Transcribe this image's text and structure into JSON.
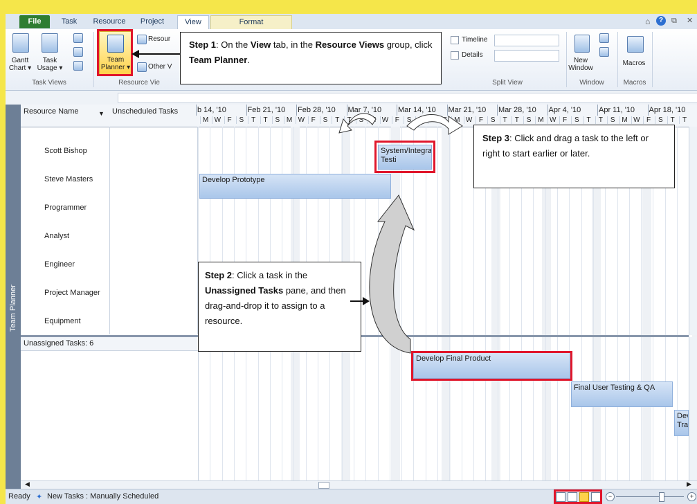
{
  "tabs": {
    "file": "File",
    "task": "Task",
    "resource": "Resource",
    "project": "Project",
    "view": "View",
    "format": "Format"
  },
  "ribbon": {
    "gantt": "Gantt",
    "chart": "Chart ▾",
    "task": "Task",
    "usage": "Usage ▾",
    "team": "Team",
    "planner": "Planner ▾",
    "resource_sheet": "Resour",
    "other_views": "Other V",
    "task_views_label": "Task Views",
    "resource_views_label": "Resource Vie",
    "timeline": "Timeline",
    "details": "Details",
    "split_view_label": "Split View",
    "new": "New",
    "window": "Window",
    "window_label": "Window",
    "macros": "Macros",
    "macros_label": "Macros"
  },
  "columns": {
    "resource_name": "Resource Name",
    "unscheduled": "Unscheduled Tasks"
  },
  "dates": [
    "b 14, '10",
    "Feb 21, '10",
    "Feb 28, '10",
    "Mar 7, '10",
    "Mar 14, '10",
    "Mar 21, '10",
    "Mar 28, '10",
    "Apr 4, '10",
    "Apr 11, '10",
    "Apr 18, '10"
  ],
  "days": [
    "M",
    "W",
    "F",
    "S",
    "T",
    "T",
    "S",
    "M",
    "W",
    "F",
    "S",
    "T",
    "T",
    "S",
    "M",
    "W",
    "F",
    "S",
    "T",
    "T",
    "S",
    "M",
    "W",
    "F",
    "S",
    "T",
    "T",
    "S",
    "M",
    "W",
    "F",
    "S",
    "T",
    "T",
    "S",
    "M",
    "W",
    "F",
    "S",
    "T",
    "T"
  ],
  "resources": [
    "Scott Bishop",
    "Steve Masters",
    "Programmer",
    "Analyst",
    "Engineer",
    "Project Manager",
    "Equipment"
  ],
  "tasks": {
    "system_integration": "System/Integration Testi",
    "develop_prototype": "Develop Prototype",
    "develop_final": "Develop Final Product",
    "final_user_testing": "Final User Testing & QA",
    "dev_training": "Deve Trai"
  },
  "unassigned_label": "Unassigned Tasks: 6",
  "sidebar_label": "Team Planner",
  "callouts": {
    "step1_bold": "Step 1",
    "step1_a": ": On the ",
    "step1_view": "View",
    "step1_b": " tab, in the ",
    "step1_rv": "Resource Views",
    "step1_c": " group, click ",
    "step1_tp": "Team Planner",
    "step1_d": ".",
    "step2_bold": "Step 2",
    "step2_a": ": Click a task in the ",
    "step2_ut": "Unassigned Tasks",
    "step2_b": " pane, and then drag-and-drop it to assign to a resource.",
    "step3_bold": "Step 3",
    "step3_a": ": Click and drag a task to the left or right to start earlier or later."
  },
  "status": {
    "ready": "Ready",
    "new_tasks": "New Tasks : Manually Scheduled"
  }
}
